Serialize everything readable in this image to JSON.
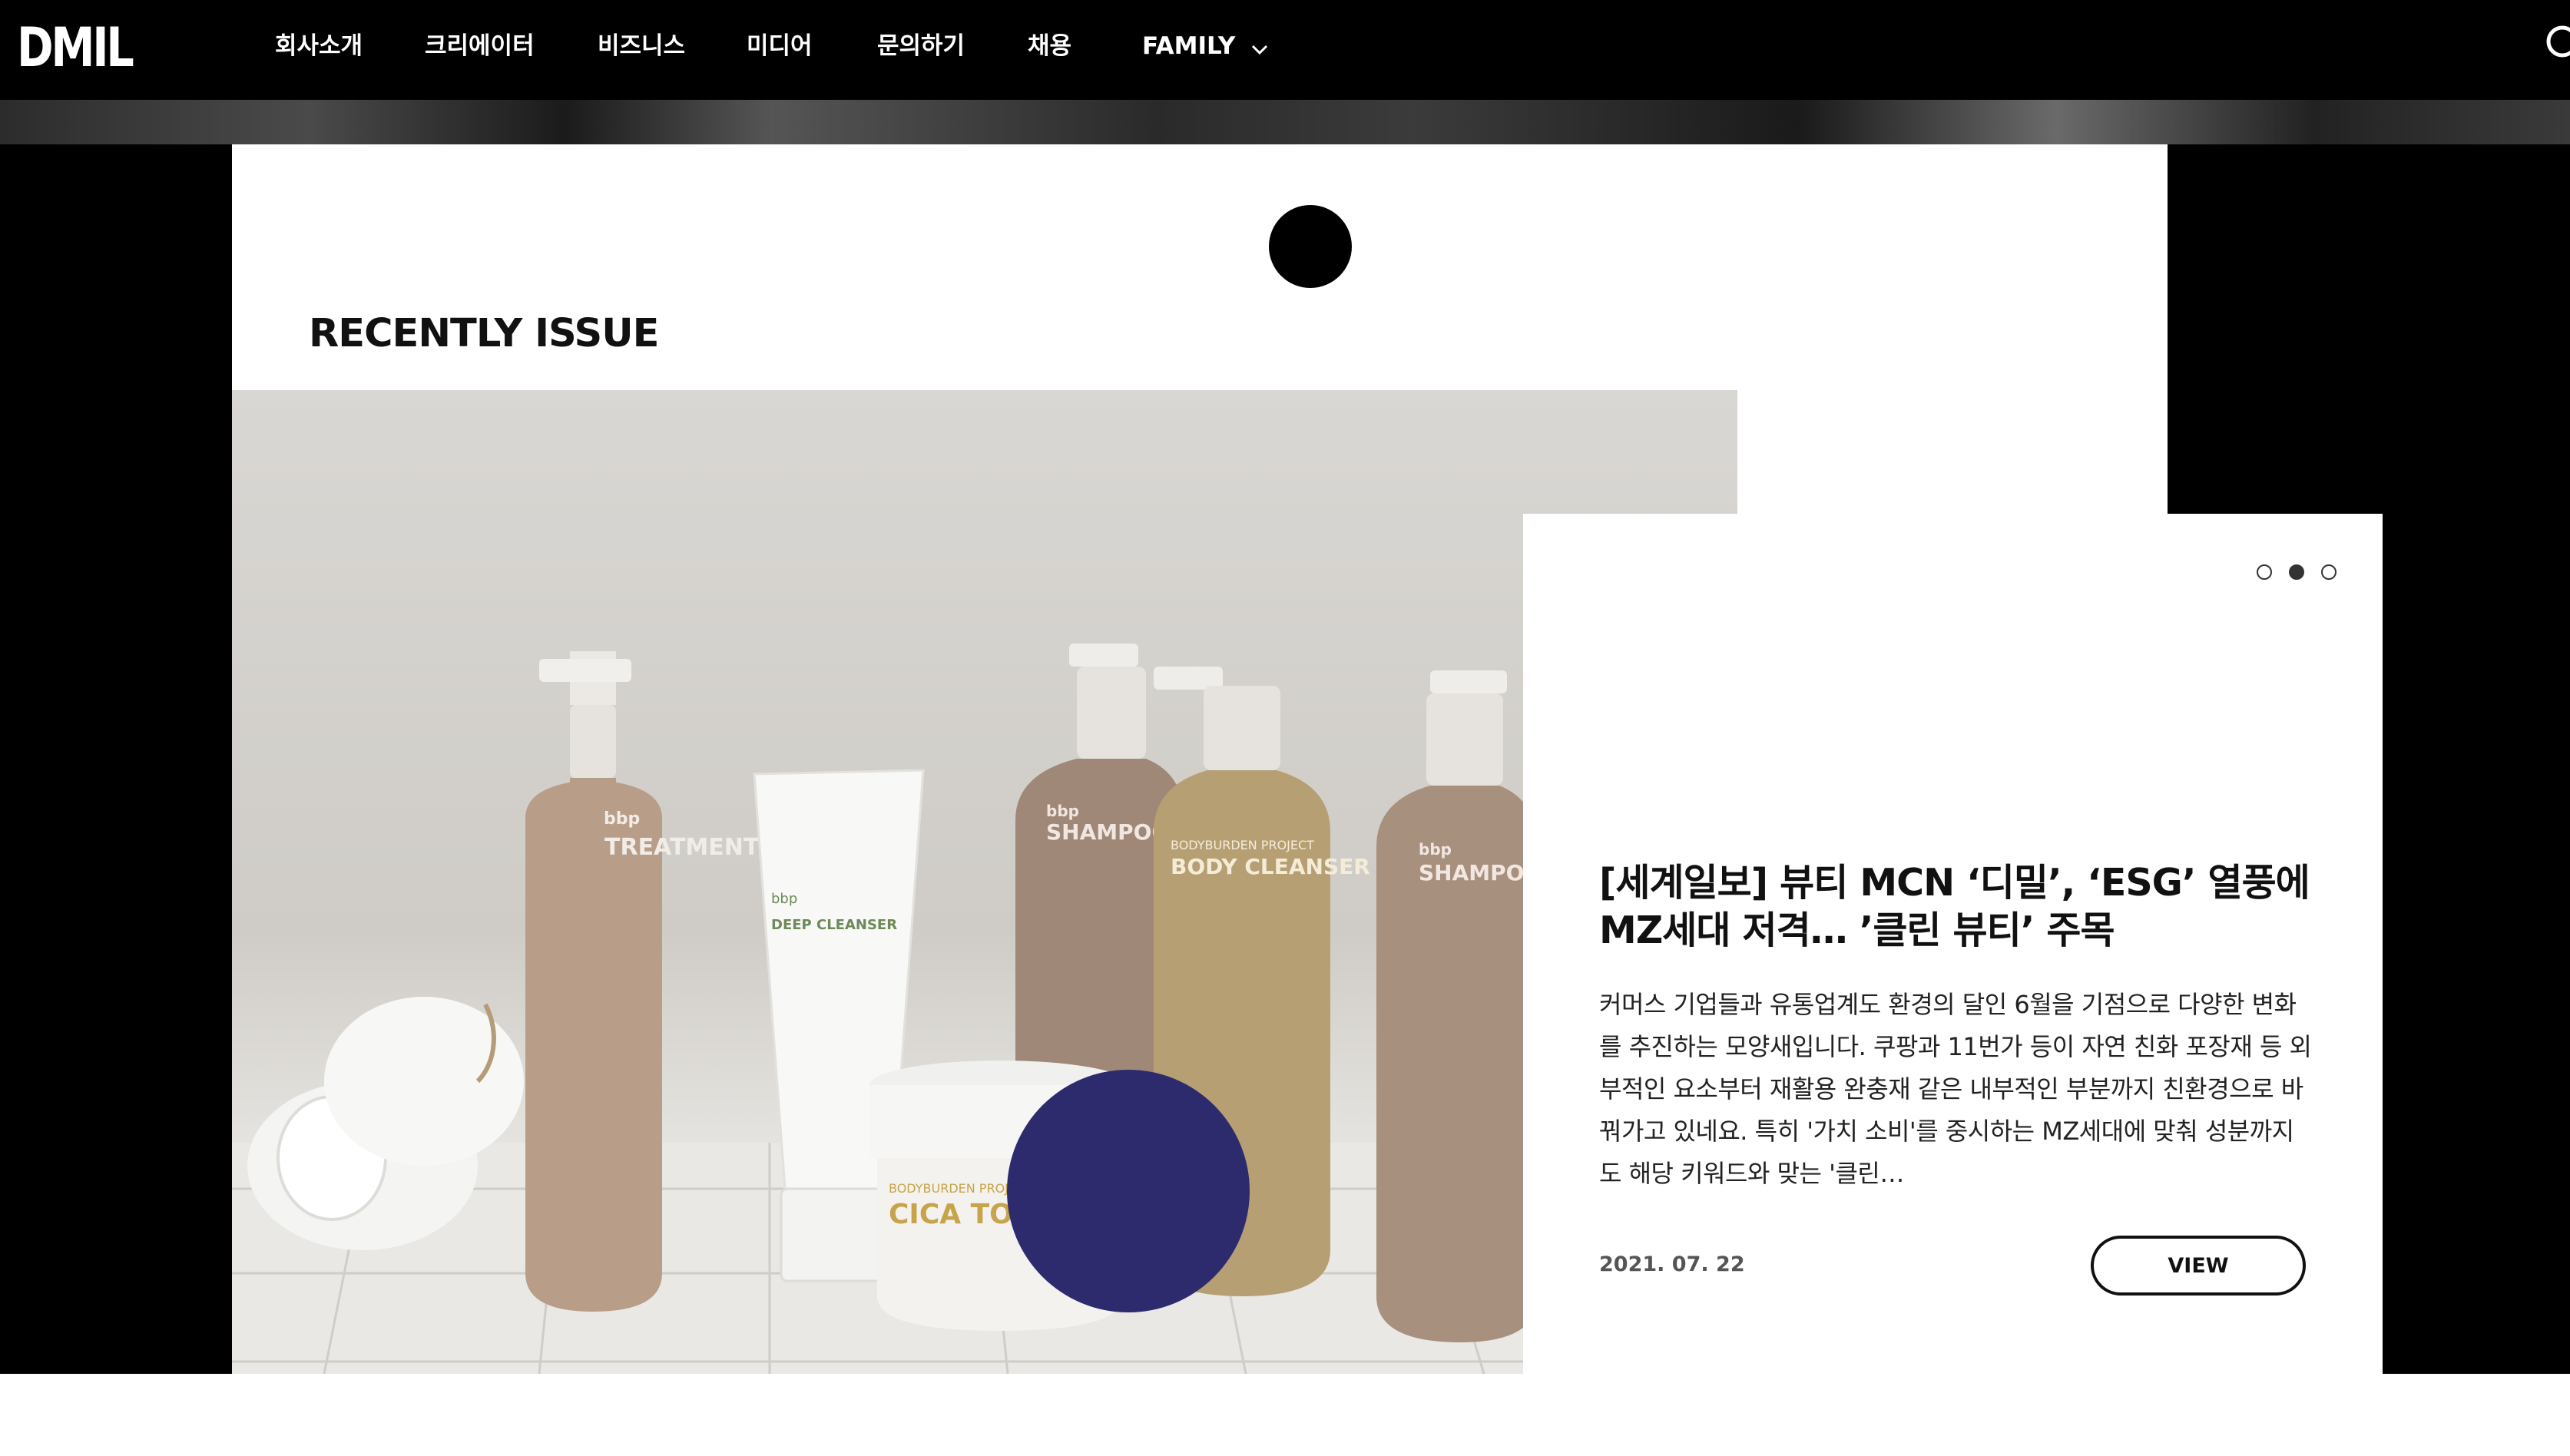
{
  "header": {
    "logo": "DMIL",
    "nav": [
      {
        "label": "회사소개"
      },
      {
        "label": "크리에이터"
      },
      {
        "label": "비즈니스"
      },
      {
        "label": "미디어"
      },
      {
        "label": "문의하기"
      },
      {
        "label": "채용"
      },
      {
        "label": "FAMILY"
      }
    ]
  },
  "section": {
    "title": "RECENTLY ISSUE"
  },
  "article": {
    "title_line1": "[세계일보] 뷰티 MCN ‘디밀’, ‘ESG’ 열풍에",
    "title_line2": "MZ세대 저격… ’클린 뷰티’ 주목",
    "body": "  커머스 기업들과 유통업계도 환경의 달인 6월을 기점으로 다양한 변화를 추진하는 모양새입니다. 쿠팡과 11번가 등이 자연 친화 포장재 등 외부적인 요소부터 재활용 완충재 같은 내부적인 부분까지 친환경으로 바꿔가고 있네요. 특히 '가치 소비'를 중시하는 MZ세대에 맞춰 성분까지도 해당 키워드와 맞는 '클린…",
    "date": "2021. 07. 22",
    "view_label": "VIEW"
  },
  "product_labels": {
    "brand": "bbp",
    "treatment": "TREATMENT",
    "cleanser": "DEEP CLEANSER",
    "shampoo": "SHAMPOO",
    "body_cleanser": "BODY CLEANSER",
    "project": "BODYBURDEN PROJECT",
    "toner": "CICA TONER"
  },
  "pager": {
    "total": 3,
    "active_index": 1
  },
  "colors": {
    "header_bg": "#000000",
    "accent_navy": "#2d2b6e",
    "accent_black": "#000000"
  }
}
